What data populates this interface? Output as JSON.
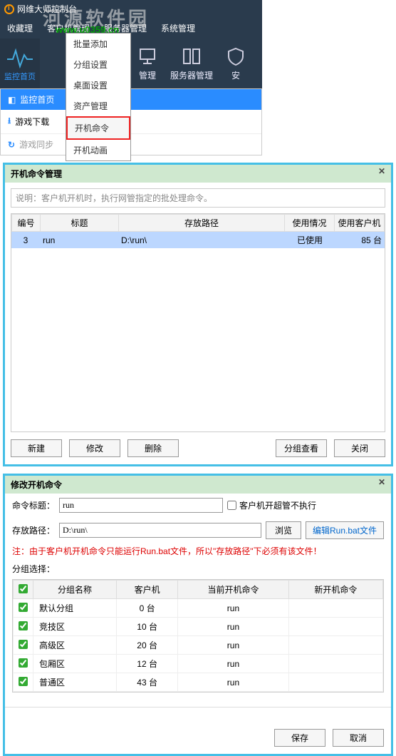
{
  "app": {
    "title": "网维大师控制台",
    "watermark": "河源软件园",
    "watermark_url": "www.u0359.cn"
  },
  "topmenu": [
    "收藏理",
    "客户机管理",
    "服务器管理",
    "系统管理"
  ],
  "dropdown": [
    "批量添加",
    "分组设置",
    "桌面设置",
    "资产管理",
    "开机命令",
    "开机动画"
  ],
  "dropdown_highlight_index": 4,
  "toolbar": {
    "logo_label": "监控首页",
    "btn2": "管理",
    "btn3": "服务器管理",
    "btn4": "安"
  },
  "side_tabs": {
    "active": "监控首页",
    "t2": "游戏下载",
    "t3": "游戏同步"
  },
  "dlg1": {
    "title": "开机命令管理",
    "hint": "说明：客户机开机时，执行网管指定的批处理命令。",
    "cols": [
      "编号",
      "标题",
      "存放路径",
      "使用情况",
      "使用客户机"
    ],
    "row": {
      "no": "3",
      "title": "run",
      "path": "D:\\run\\",
      "use": "已使用",
      "count": "85 台"
    },
    "btns": {
      "new": "新建",
      "edit": "修改",
      "del": "删除",
      "group": "分组查看",
      "close": "关闭"
    }
  },
  "dlg2": {
    "title": "修改开机命令",
    "label_title": "命令标题：",
    "val_title": "run",
    "chk_super": "客户机开超管不执行",
    "label_path": "存放路径：",
    "val_path": "D:\\run\\",
    "btn_browse": "浏览",
    "btn_editbat": "编辑Run.bat文件",
    "note": "注：由于客户机开机命令只能运行Run.bat文件，所以\"存放路径\"下必须有该文件！",
    "sect": "分组选择：",
    "cols": [
      "分组名称",
      "客户机",
      "当前开机命令",
      "新开机命令"
    ],
    "rows": [
      {
        "name": "默认分组",
        "clients": "0 台",
        "cur": "run",
        "new": ""
      },
      {
        "name": "竞技区",
        "clients": "10 台",
        "cur": "run",
        "new": ""
      },
      {
        "name": "高级区",
        "clients": "20 台",
        "cur": "run",
        "new": ""
      },
      {
        "name": "包厢区",
        "clients": "12 台",
        "cur": "run",
        "new": ""
      },
      {
        "name": "普通区",
        "clients": "43 台",
        "cur": "run",
        "new": ""
      }
    ],
    "btn_save": "保存",
    "btn_cancel": "取消"
  }
}
